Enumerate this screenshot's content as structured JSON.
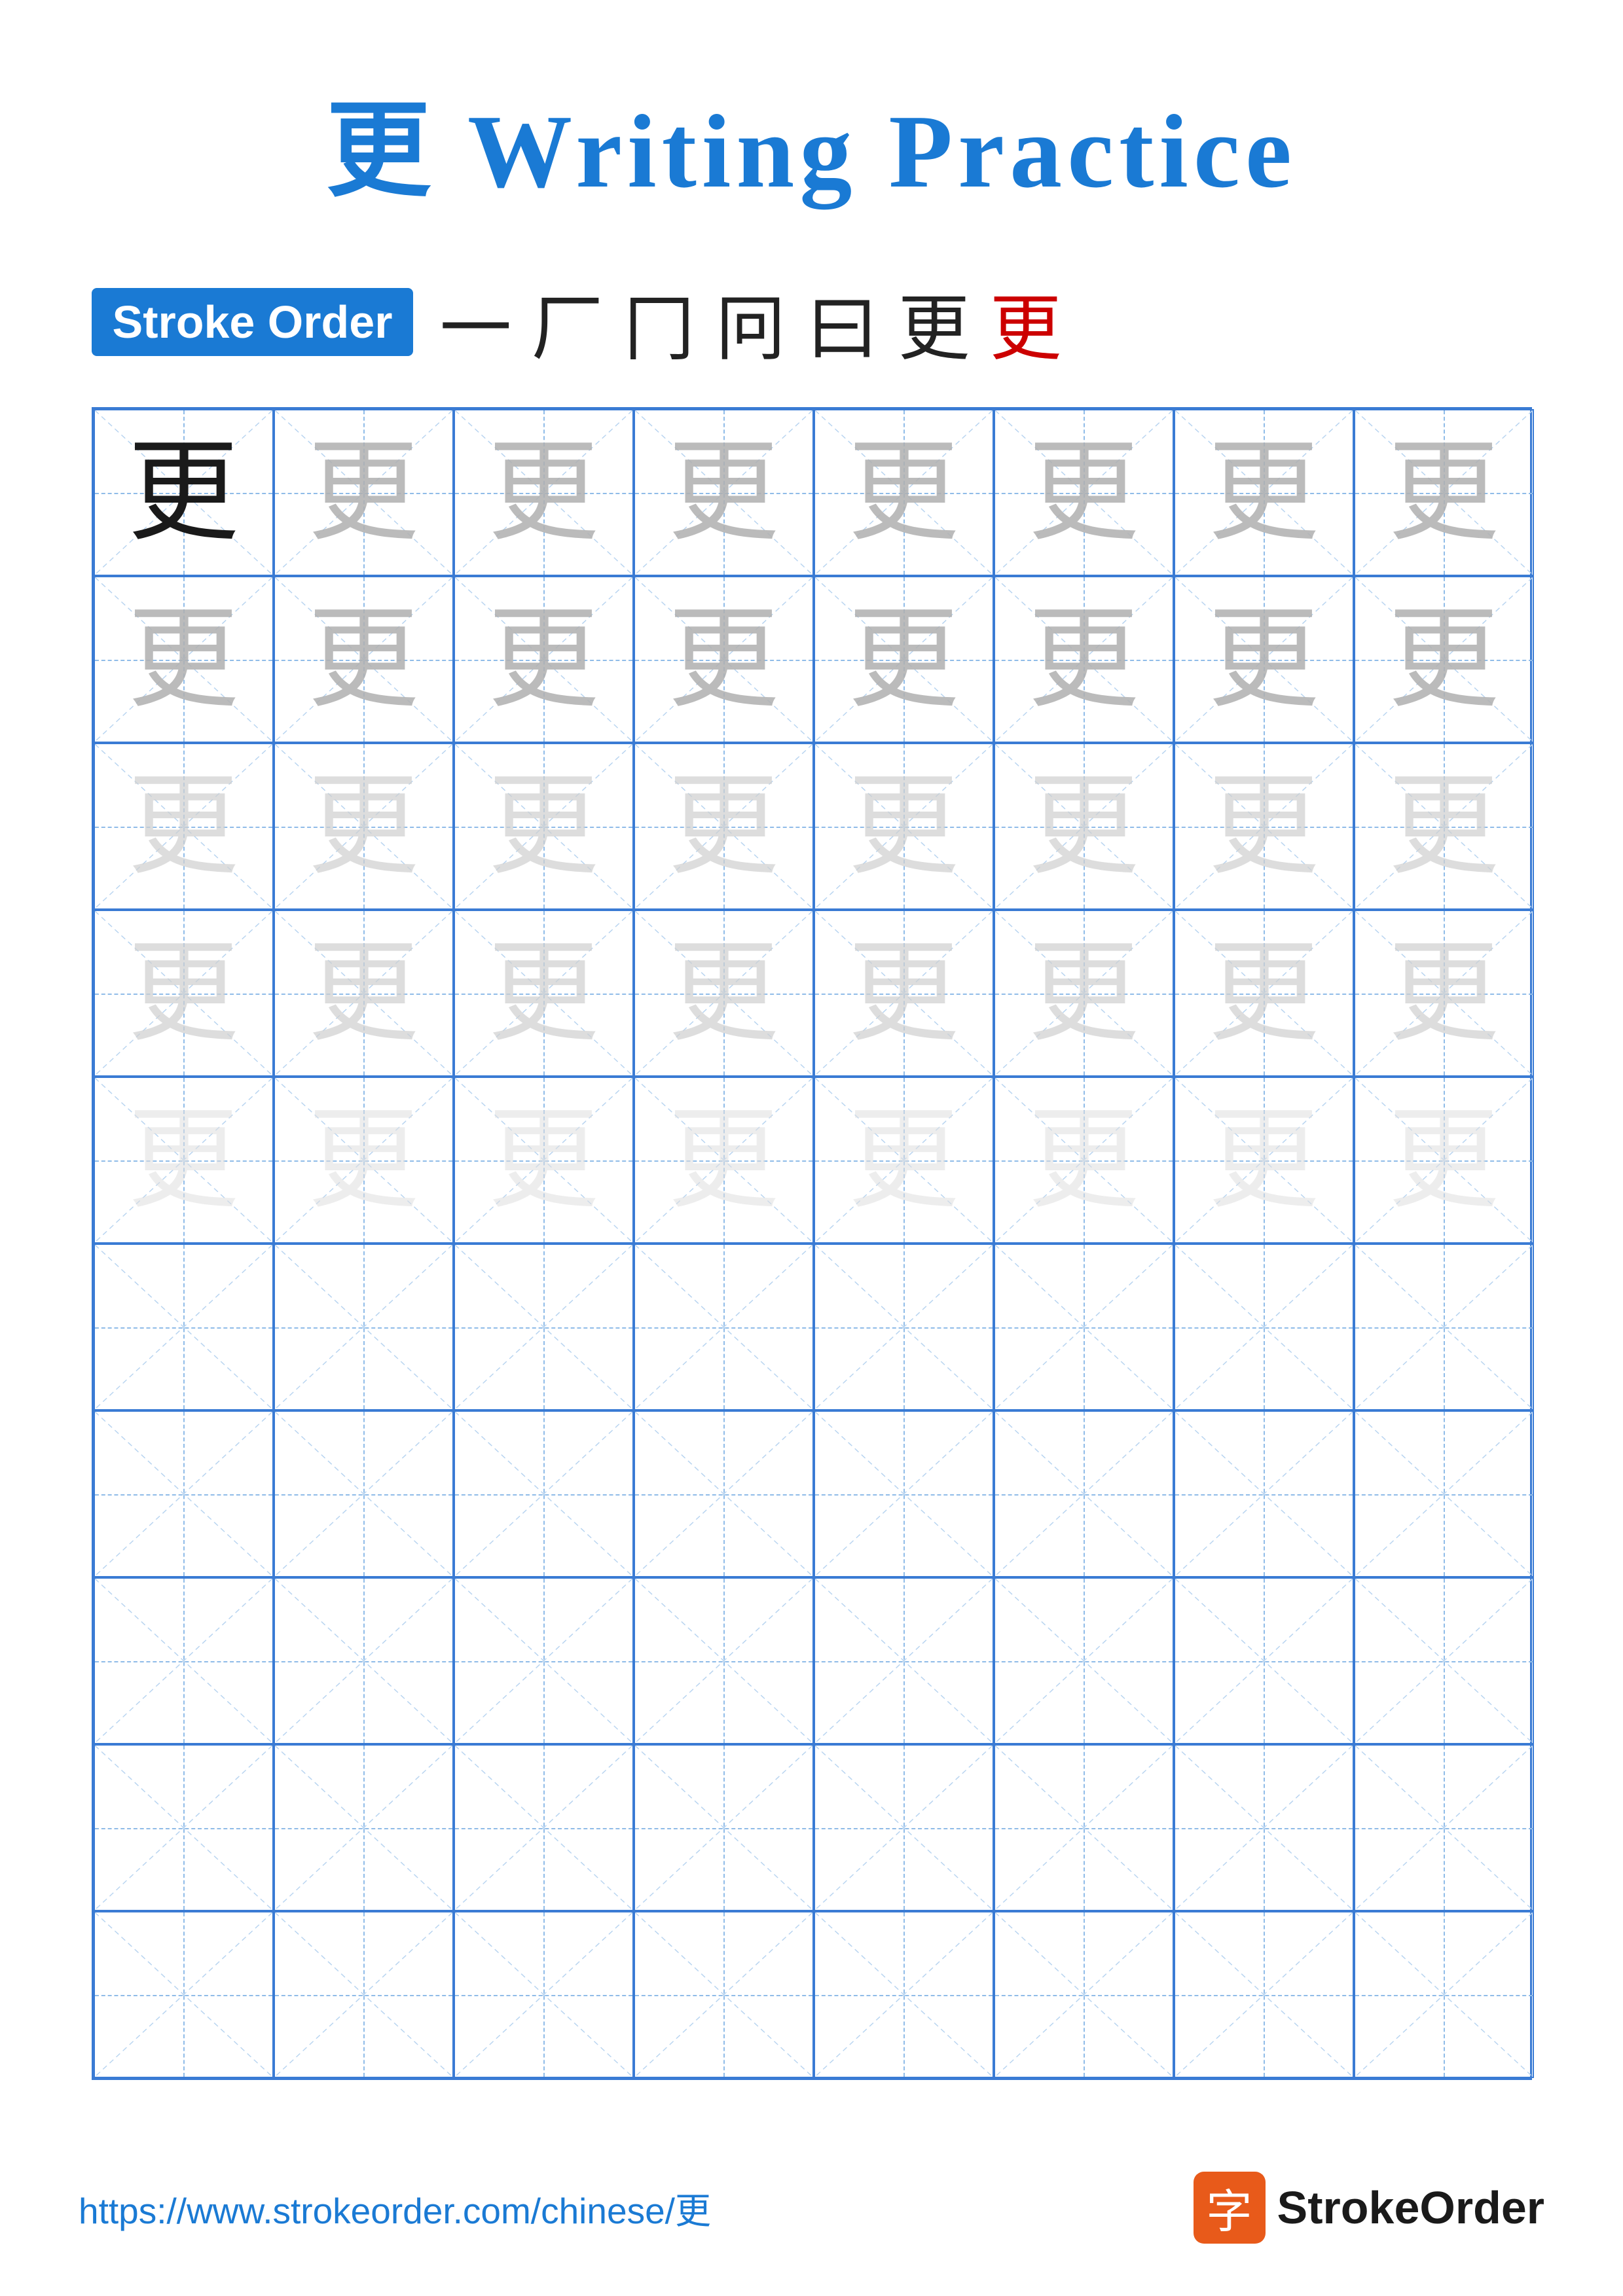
{
  "title": "更 Writing Practice",
  "stroke_order": {
    "label": "Stroke Order",
    "chars": [
      "一",
      "厂",
      "冂",
      "冋",
      "曰",
      "更",
      "更"
    ]
  },
  "character": "更",
  "grid": {
    "cols": 8,
    "rows": 10,
    "practice_rows": 5,
    "empty_rows": 5
  },
  "footer": {
    "url": "https://www.strokeorder.com/chinese/更",
    "logo_text": "StrokeOrder",
    "logo_char": "字"
  }
}
